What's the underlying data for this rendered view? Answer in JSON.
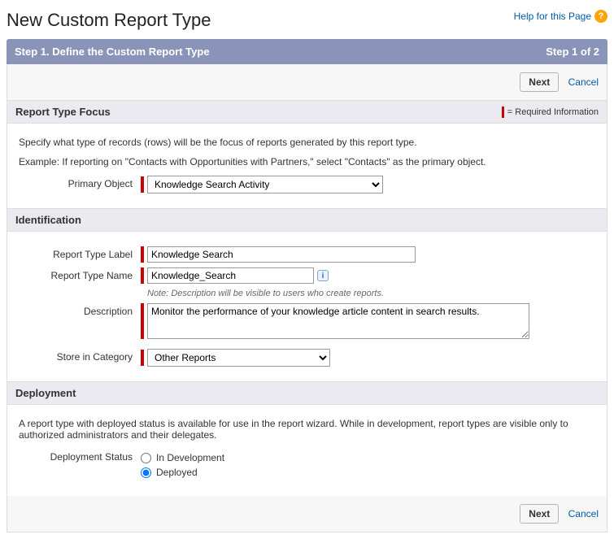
{
  "header": {
    "title": "New Custom Report Type",
    "help_label": "Help for this Page"
  },
  "step_bar": {
    "left": "Step 1. Define the Custom Report Type",
    "right": "Step 1 of 2"
  },
  "buttons": {
    "next": "Next",
    "cancel": "Cancel"
  },
  "focus_section": {
    "heading": "Report Type Focus",
    "required_text": "= Required Information",
    "instruction1": "Specify what type of records (rows) will be the focus of reports generated by this report type.",
    "instruction2": "Example: If reporting on \"Contacts with Opportunities with Partners,\" select \"Contacts\" as the primary object.",
    "primary_object_label": "Primary Object",
    "primary_object_value": "Knowledge Search Activity"
  },
  "identification_section": {
    "heading": "Identification",
    "label_label": "Report Type Label",
    "label_value": "Knowledge Search",
    "name_label": "Report Type Name",
    "name_value": "Knowledge_Search",
    "note": "Note: Description will be visible to users who create reports.",
    "description_label": "Description",
    "description_value": "Monitor the performance of your knowledge article content in search results.",
    "category_label": "Store in Category",
    "category_value": "Other Reports"
  },
  "deployment_section": {
    "heading": "Deployment",
    "instruction": "A report type with deployed status is available for use in the report wizard. While in development, report types are visible only to authorized administrators and their delegates.",
    "status_label": "Deployment Status",
    "option1": "In Development",
    "option2": "Deployed",
    "selected": "Deployed"
  }
}
